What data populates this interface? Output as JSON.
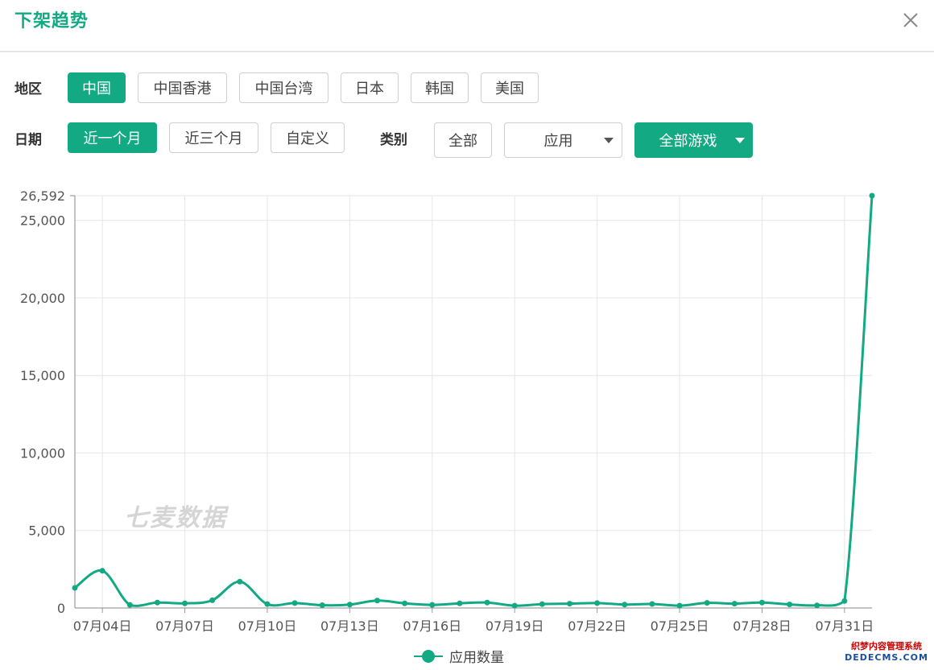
{
  "modal": {
    "title": "下架趋势",
    "close_icon": "close-icon"
  },
  "filters": {
    "region_label": "地区",
    "regions": [
      {
        "label": "中国",
        "active": true
      },
      {
        "label": "中国香港",
        "active": false
      },
      {
        "label": "中国台湾",
        "active": false
      },
      {
        "label": "日本",
        "active": false
      },
      {
        "label": "韩国",
        "active": false
      },
      {
        "label": "美国",
        "active": false
      }
    ],
    "date_label": "日期",
    "dates": [
      {
        "label": "近一个月",
        "active": true
      },
      {
        "label": "近三个月",
        "active": false
      },
      {
        "label": "自定义",
        "active": false
      }
    ],
    "category_label": "类别",
    "category_all": "全部",
    "category_select": "应用",
    "game_select": "全部游戏"
  },
  "chart_data": {
    "type": "line",
    "x": [
      "07月03日",
      "07月04日",
      "07月05日",
      "07月06日",
      "07月07日",
      "07月08日",
      "07月09日",
      "07月10日",
      "07月11日",
      "07月12日",
      "07月13日",
      "07月14日",
      "07月15日",
      "07月16日",
      "07月17日",
      "07月18日",
      "07月19日",
      "07月20日",
      "07月21日",
      "07月22日",
      "07月23日",
      "07月24日",
      "07月25日",
      "07月26日",
      "07月27日",
      "07月28日",
      "07月29日",
      "07月30日",
      "07月31日",
      "08月01日"
    ],
    "x_tick_labels": [
      "07月04日",
      "07月07日",
      "07月10日",
      "07月13日",
      "07月16日",
      "07月19日",
      "07月22日",
      "07月25日",
      "07月28日",
      "07月31日"
    ],
    "series": [
      {
        "name": "应用数量",
        "color": "#12a983",
        "values": [
          1300,
          2400,
          200,
          350,
          300,
          500,
          1700,
          250,
          320,
          180,
          220,
          480,
          300,
          200,
          300,
          350,
          150,
          250,
          280,
          320,
          220,
          260,
          150,
          330,
          280,
          350,
          230,
          170,
          450,
          26592
        ]
      }
    ],
    "y_ticks": [
      0,
      5000,
      10000,
      15000,
      20000,
      25000,
      26592
    ],
    "y_tick_labels": [
      "0",
      "5,000",
      "10,000",
      "15,000",
      "20,000",
      "25,000",
      "26,592"
    ],
    "ylim": [
      0,
      26592
    ],
    "grid": true,
    "legend": "bottom-center"
  },
  "watermark": "七麦数据",
  "corner_logo": {
    "line1": "织梦内容管理系统",
    "line2": "DEDECMS.COM"
  }
}
